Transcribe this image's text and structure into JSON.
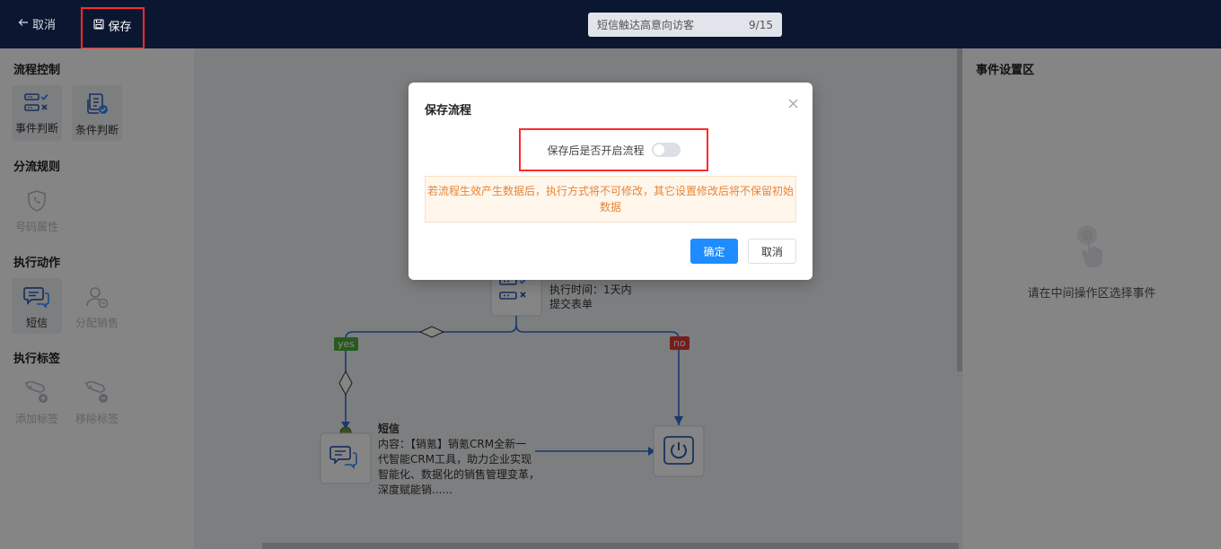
{
  "topbar": {
    "cancel_label": "取消",
    "save_label": "保存",
    "flow_name": "短信触达高意向访客",
    "name_count": "9/15"
  },
  "left_panel": {
    "sections": [
      {
        "title": "流程控制",
        "tools": [
          {
            "label": "事件判断",
            "icon": "event-judge-icon"
          },
          {
            "label": "条件判断",
            "icon": "condition-judge-icon"
          }
        ]
      },
      {
        "title": "分流规则",
        "tools": [
          {
            "label": "号码属性",
            "icon": "phone-shield-icon"
          }
        ]
      },
      {
        "title": "执行动作",
        "tools": [
          {
            "label": "短信",
            "icon": "chat-bubble-icon"
          },
          {
            "label": "分配销售",
            "icon": "assign-user-icon"
          }
        ]
      },
      {
        "title": "执行标签",
        "tools": [
          {
            "label": "添加标签",
            "icon": "tag-add-icon"
          },
          {
            "label": "移除标签",
            "icon": "tag-remove-icon"
          }
        ]
      }
    ]
  },
  "canvas": {
    "event_node": {
      "line1": "执行时间：1天内",
      "line2": "提交表单"
    },
    "yes_label": "yes",
    "no_label": "no",
    "sms_node": {
      "title": "短信",
      "lines": [
        "内容：【销氪】销氪CRM全新一",
        "代智能CRM工具，助力企业实现",
        "智能化、数据化的销售管理变革，",
        "深度赋能销......"
      ]
    }
  },
  "right_panel": {
    "title": "事件设置区",
    "hint": "请在中间操作区选择事件"
  },
  "dialog": {
    "title": "保存流程",
    "toggle_label": "保存后是否开启流程",
    "toggle_on": false,
    "warning_line1": "若流程生效产生数据后，执行方式将不可修改，其它设置修改后将不保留初始",
    "warning_line2": "数据",
    "ok_label": "确定",
    "cancel_label": "取消"
  },
  "colors": {
    "topbar_bg": "#0b1731",
    "primary": "#1e8cff",
    "yes_green": "#4caf3a",
    "no_red": "#e53935",
    "highlight_red": "#ff2a2a",
    "warning_text": "#e6863a"
  }
}
